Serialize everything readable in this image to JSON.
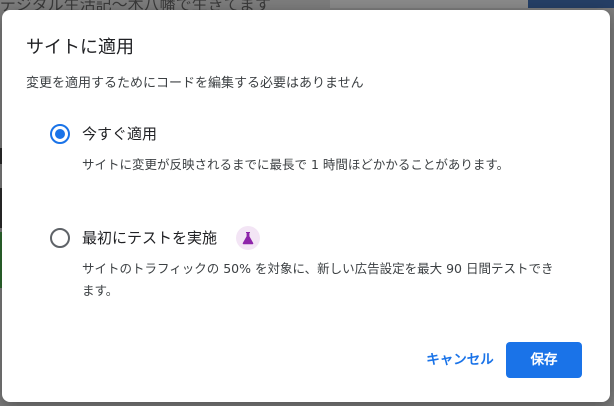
{
  "background": {
    "page_title": "デジタル生活記〜木八幡で生きてます"
  },
  "dialog": {
    "title": "サイトに適用",
    "subtitle": "変更を適用するためにコードを編集する必要はありません",
    "options": [
      {
        "label": "今すぐ適用",
        "description": "サイトに変更が反映されるまでに最長で 1 時間ほどかかることがあります。",
        "selected": true
      },
      {
        "label": "最初にテストを実施",
        "description": "サイトのトラフィックの 50% を対象に、新しい広告設定を最大 90 日間テストできます。",
        "selected": false,
        "badge_icon": "flask-icon"
      }
    ],
    "buttons": {
      "cancel": "キャンセル",
      "save": "保存"
    }
  },
  "colors": {
    "accent": "#1a73e8",
    "badge_bg": "#f3e5f5",
    "badge_icon": "#8e24aa"
  }
}
